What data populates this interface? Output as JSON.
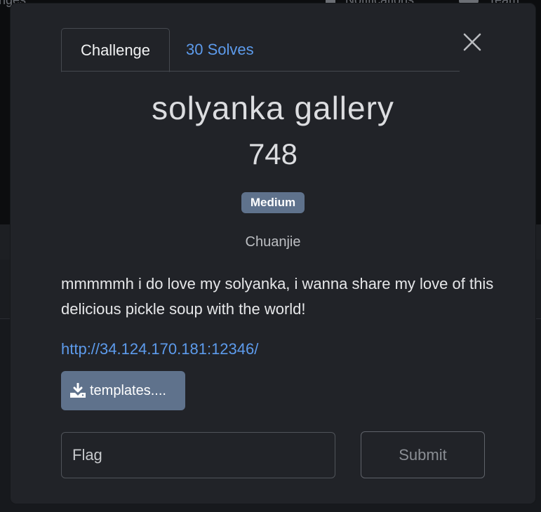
{
  "background": {
    "left_text": "nges",
    "notifications": "Notifications",
    "team": "Team"
  },
  "tabs": {
    "challenge": "Challenge",
    "solves": "30 Solves"
  },
  "challenge": {
    "name": "solyanka gallery",
    "points": "748",
    "difficulty": "Medium",
    "author": "Chuanjie",
    "description": "mmmmmh i do love my solyanka, i wanna share my love of this delicious pickle soup with the world!",
    "url": "http://34.124.170.181:12346/",
    "file_label": "templates...."
  },
  "form": {
    "flag_placeholder": "Flag",
    "submit_label": "Submit"
  },
  "colors": {
    "accent_link": "#5d9bec",
    "badge_bg": "#5f728c",
    "modal_bg": "#212328"
  },
  "icons": {
    "close": "close-icon",
    "download": "download-icon"
  }
}
